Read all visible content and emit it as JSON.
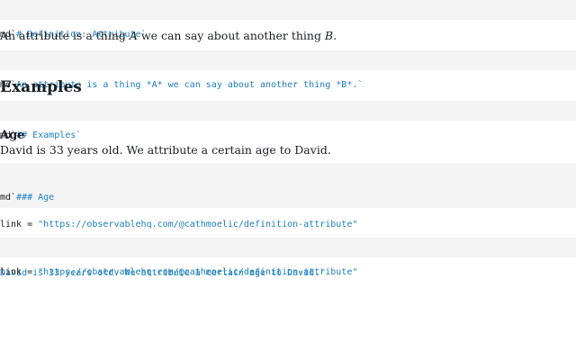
{
  "cells": {
    "md_title": {
      "prefix": "md`",
      "content": "# Definition: Attribute",
      "suffix": "`"
    },
    "md_definition": {
      "prefix": "md`",
      "content": "An attribute is a thing *A* we can say about another thing *B*.",
      "suffix": "`"
    },
    "md_examples": {
      "prefix": "md`",
      "content": "## Examples",
      "suffix": "`"
    },
    "md_age": {
      "prefix": "md`",
      "line1": "### Age",
      "line3": "David is 33 years old. We attribute a certain age to David.",
      "suffix": "`"
    },
    "link": {
      "prefix": "link = ",
      "value": "\"https://observablehq.com/@cathmoelic/definition-attribute\""
    }
  },
  "outputs": {
    "definition": {
      "text_before": "An attribute is a thing ",
      "em_a": "A",
      "text_middle": " we can say about another thing ",
      "em_b": "B",
      "text_after": "."
    },
    "examples_heading": "Examples",
    "age_heading": "Age",
    "age_text": "David is 33 years old. We attribute a certain age to David.",
    "link_output": {
      "prefix": "link = ",
      "value": "\"https://observablehq.com/@cathmoelic/definition-attribute\""
    }
  },
  "colors": {
    "cell_background": "#f4f4f4",
    "string_color": "#1d7fbd",
    "text_color": "#1b1e23"
  }
}
